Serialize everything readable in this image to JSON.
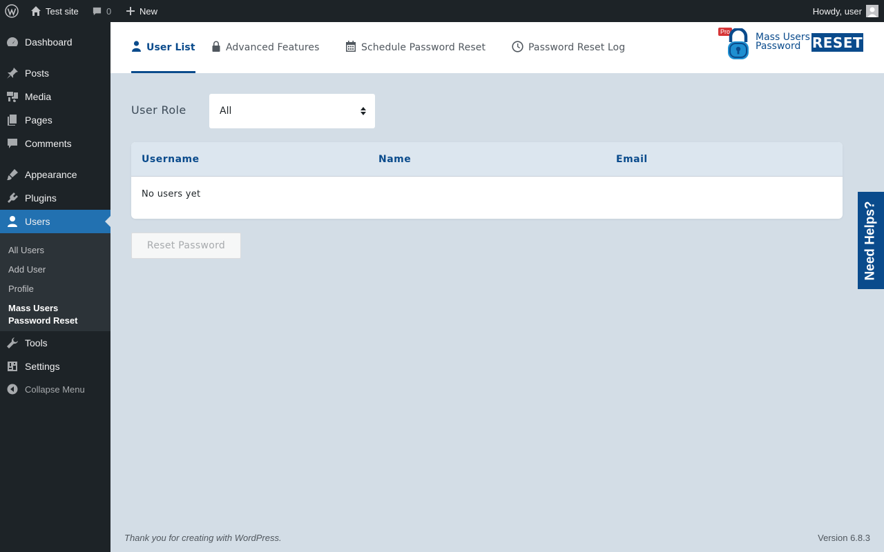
{
  "admin_bar": {
    "site_name": "Test site",
    "comments_count": "0",
    "new_label": "New",
    "howdy": "Howdy, user"
  },
  "sidebar": {
    "items": [
      {
        "label": "Dashboard",
        "icon": "dashboard-icon"
      },
      {
        "label": "Posts",
        "icon": "pin-icon"
      },
      {
        "label": "Media",
        "icon": "media-icon"
      },
      {
        "label": "Pages",
        "icon": "pages-icon"
      },
      {
        "label": "Comments",
        "icon": "comment-icon"
      },
      {
        "label": "Appearance",
        "icon": "brush-icon"
      },
      {
        "label": "Plugins",
        "icon": "plugin-icon"
      },
      {
        "label": "Users",
        "icon": "user-icon"
      },
      {
        "label": "Tools",
        "icon": "wrench-icon"
      },
      {
        "label": "Settings",
        "icon": "settings-icon"
      }
    ],
    "submenu": [
      "All Users",
      "Add User",
      "Profile",
      "Mass Users",
      "Password Reset"
    ],
    "collapse_label": "Collapse Menu"
  },
  "tabs": [
    {
      "label": "User List",
      "icon": "user-icon"
    },
    {
      "label": "Advanced Features",
      "icon": "lock-icon"
    },
    {
      "label": "Schedule Password Reset",
      "icon": "calendar-icon"
    },
    {
      "label": "Password Reset Log",
      "icon": "clock-icon"
    }
  ],
  "logo": {
    "pro": "Pro",
    "line1": "Mass Users",
    "line2": "Password",
    "reset": "RESET"
  },
  "filter": {
    "label": "User Role",
    "selected": "All"
  },
  "table": {
    "columns": [
      "Username",
      "Name",
      "Email"
    ],
    "empty_text": "No users yet"
  },
  "reset_button": "Reset Password",
  "need_help": "Need Helps?",
  "footer": {
    "thanks": "Thank you for creating with WordPress.",
    "version": "Version 6.8.3"
  },
  "colors": {
    "accent": "#0a4b8c",
    "wp_blue": "#2271b1",
    "admin_dark": "#1d2327",
    "content_bg": "#d3dde6"
  }
}
